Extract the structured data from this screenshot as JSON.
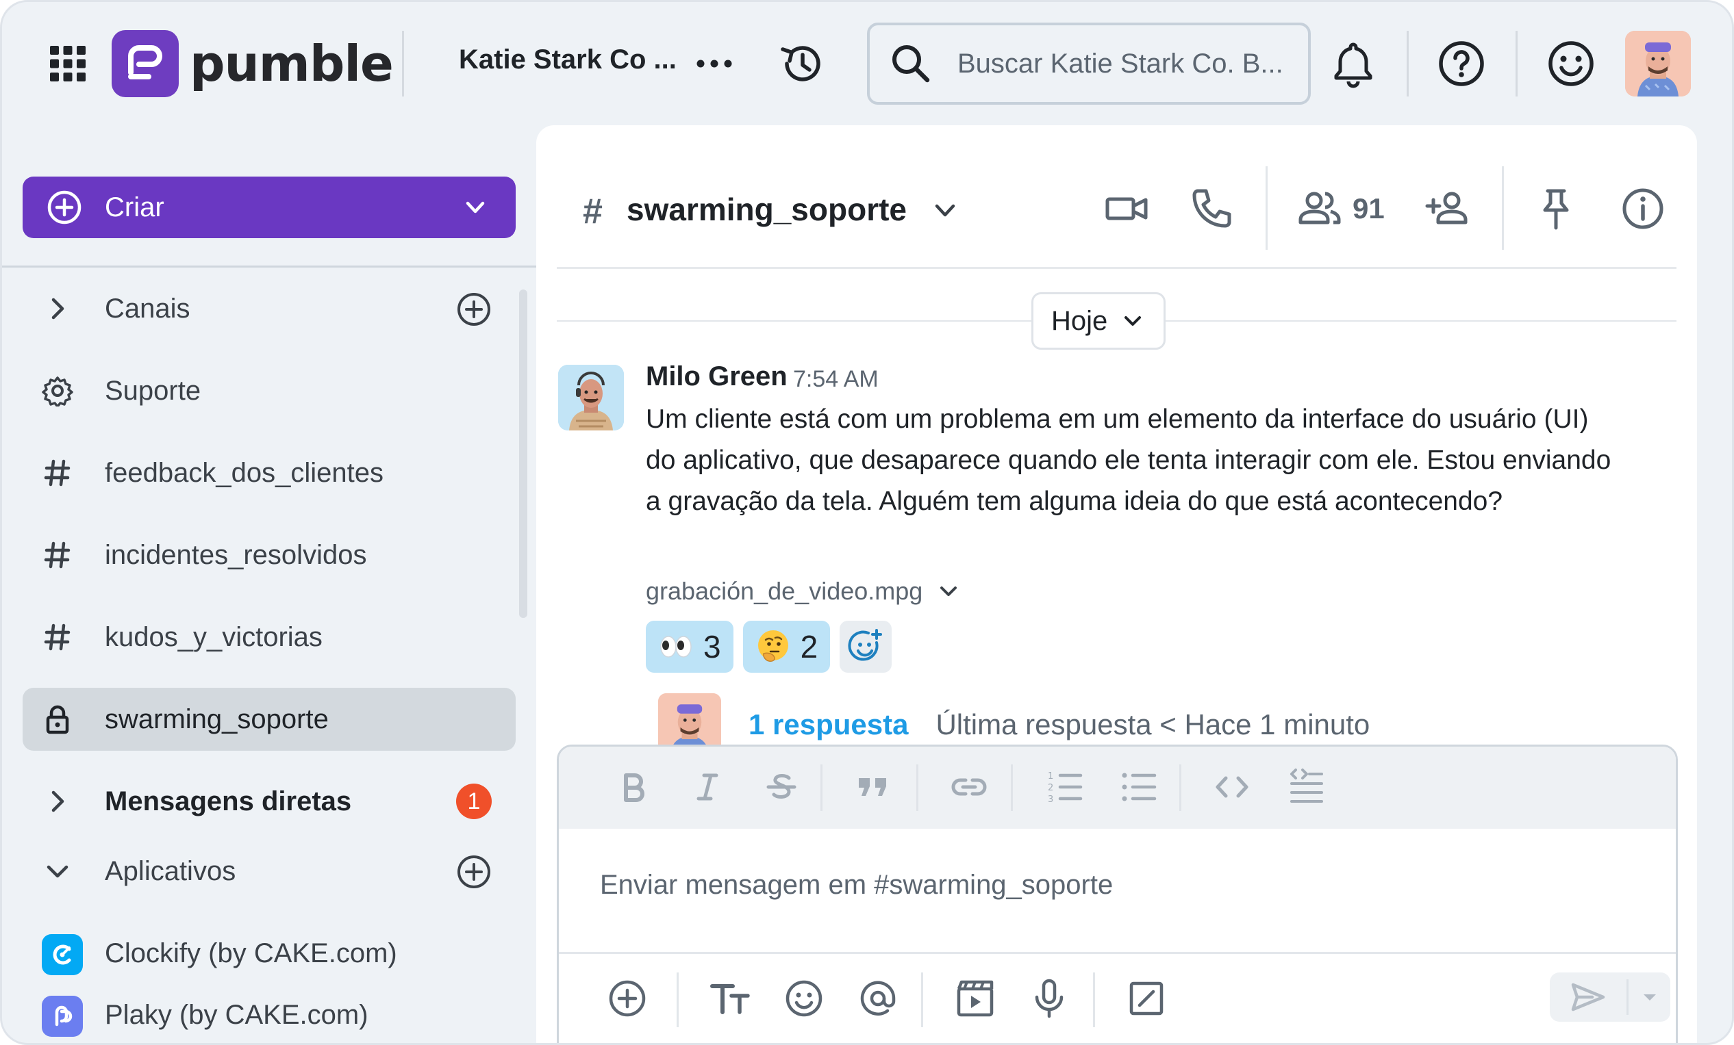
{
  "app": {
    "logo_text": "pumble",
    "workspace_name": "Katie Stark Co ...",
    "search_placeholder": "Buscar Katie Stark Co. B..."
  },
  "sidebar": {
    "create_label": "Criar",
    "items": [
      {
        "label": "Canais",
        "icon": "chevron-right-icon"
      },
      {
        "label": "Suporte",
        "icon": "gear-icon"
      },
      {
        "label": "feedback_dos_clientes",
        "icon": "hash-icon"
      },
      {
        "label": "incidentes_resolvidos",
        "icon": "hash-icon"
      },
      {
        "label": "kudos_y_victorias",
        "icon": "hash-icon"
      },
      {
        "label": "swarming_soporte",
        "icon": "lock-icon",
        "active": true
      },
      {
        "label": "Mensagens diretas",
        "icon": "chevron-right-icon",
        "badge": "1"
      },
      {
        "label": "Aplicativos",
        "icon": "chevron-down-icon"
      },
      {
        "label": "Clockify (by CAKE.com)",
        "icon": "clockify-logo"
      },
      {
        "label": "Plaky (by CAKE.com)",
        "icon": "plaky-logo"
      }
    ]
  },
  "channel": {
    "hash": "#",
    "name": "swarming_soporte",
    "member_count": "91"
  },
  "feed": {
    "date_label": "Hoje",
    "message": {
      "author": "Milo Green",
      "time": "7:54 AM",
      "lines": [
        "Um cliente está com um problema em um elemento da interface do usuário (UI)",
        "do aplicativo, que desaparece quando ele tenta interagir com ele. Estou enviando",
        "a gravação da tela. Alguém tem alguma ideia do que está acontecendo?"
      ],
      "attachment": "grabación_de_video.mpg",
      "reactions": [
        {
          "emoji": "eyes-emoji",
          "count": "3"
        },
        {
          "emoji": "thinking-face-emoji",
          "count": "2"
        }
      ],
      "thread": {
        "replies_label": "1 respuesta",
        "last_reply": "Última respuesta < Hace 1 minuto"
      }
    }
  },
  "composer": {
    "placeholder": "Enviar mensagem em #swarming_soporte"
  },
  "colors": {
    "brand": "#6a38c2",
    "badge": "#f0502a",
    "link": "#1e9be5",
    "reaction_bg": "#bde3f7",
    "active_item_bg": "#d3d9de"
  }
}
